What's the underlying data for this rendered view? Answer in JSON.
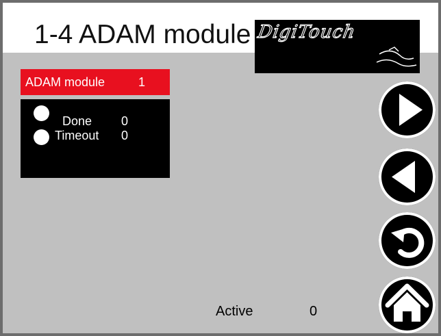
{
  "screen": {
    "title": "1-4 ADAM module",
    "logo_text": "DigiTouch"
  },
  "module_tag": {
    "label": "ADAM module",
    "number": "1",
    "color": "#e8101f"
  },
  "status": {
    "items": [
      {
        "label": "Done",
        "value": "0"
      },
      {
        "label": "Timeout",
        "value": "0"
      }
    ]
  },
  "footer": {
    "active_label": "Active",
    "active_value": "0"
  },
  "nav": {
    "buttons": [
      {
        "icon": "play-forward-icon"
      },
      {
        "icon": "play-back-icon"
      },
      {
        "icon": "return-arrow-icon"
      },
      {
        "icon": "home-icon"
      }
    ]
  }
}
